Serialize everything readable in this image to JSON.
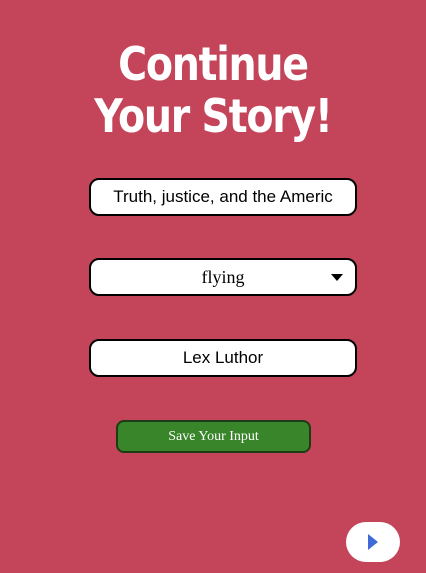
{
  "title": {
    "line1": "Continue",
    "line2": "Your Story!"
  },
  "form": {
    "motto_value": "Truth, justice, and the Americ",
    "power_select": {
      "selected": "flying",
      "icon": "caret-down-icon"
    },
    "villain_value": "Lex Luthor",
    "save_label": "Save Your Input"
  },
  "navigation": {
    "next_icon": "play-icon"
  },
  "colors": {
    "background": "#c4445a",
    "save_button": "#38852a",
    "next_arrow": "#3f6ad8"
  }
}
